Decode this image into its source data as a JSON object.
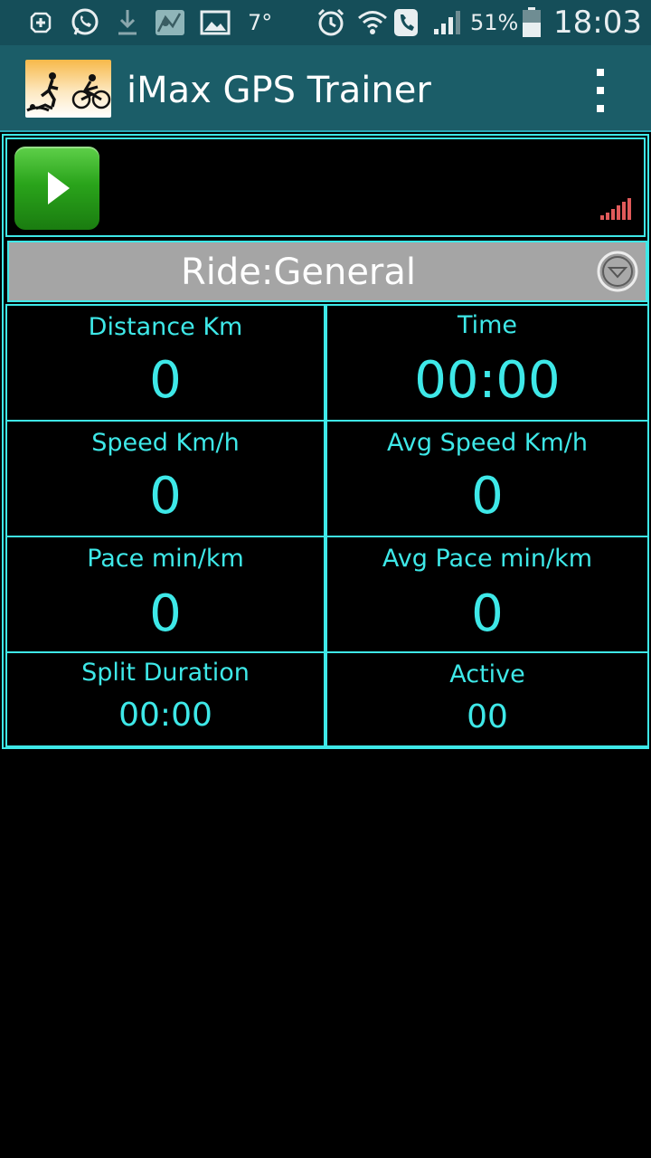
{
  "status_bar": {
    "temperature": "7°",
    "battery": "51%",
    "time": "18:03",
    "icons": [
      "add-icon",
      "whatsapp-icon",
      "download-icon",
      "map-icon",
      "gallery-icon",
      "alarm-icon",
      "wifi-icon",
      "phone-icon",
      "cell-signal-icon",
      "battery-icon"
    ]
  },
  "app_bar": {
    "title": "iMax GPS Trainer",
    "menu_icon": "overflow-menu-icon"
  },
  "controls": {
    "play_icon": "play-icon",
    "signal_icon": "gps-signal-icon"
  },
  "mode": {
    "label": "Ride:General",
    "dropdown_icon": "chevron-down-icon"
  },
  "stats": [
    {
      "label": "Distance Km",
      "value": "0"
    },
    {
      "label": "Time",
      "value": "00:00"
    },
    {
      "label": "Speed Km/h",
      "value": "0"
    },
    {
      "label": "Avg Speed Km/h",
      "value": "0"
    },
    {
      "label": "Pace min/km",
      "value": "0"
    },
    {
      "label": "Avg Pace min/km",
      "value": "0"
    },
    {
      "label": "Split Duration",
      "value": "00:00"
    },
    {
      "label": "Active",
      "value": "00"
    }
  ],
  "colors": {
    "accent": "#3ee8e8",
    "status_bar": "#154e59",
    "app_bar": "#1b5d68",
    "play_green": "#2aa41b",
    "mode_bg": "#a5a5a5"
  }
}
